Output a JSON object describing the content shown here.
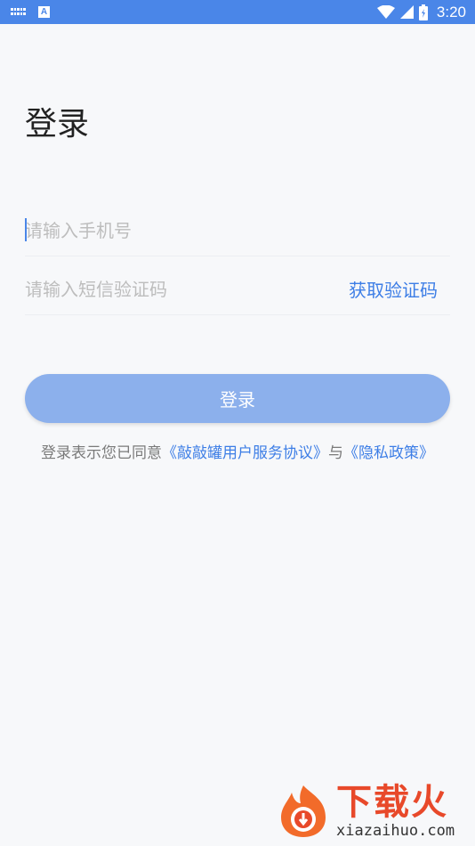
{
  "status_bar": {
    "time": "3:20",
    "battery_text": "",
    "icons": [
      "keyboard-icon",
      "a-notification-icon",
      "wifi-icon",
      "signal-icon",
      "battery-icon"
    ]
  },
  "page": {
    "title": "登录"
  },
  "form": {
    "phone_placeholder": "请输入手机号",
    "code_placeholder": "请输入短信验证码",
    "get_code_label": "获取验证码",
    "login_label": "登录"
  },
  "agreement": {
    "prefix": "登录表示您已同意",
    "terms_link": "《敲敲罐用户服务协议》",
    "conjunction": "与",
    "privacy_link": "《隐私政策》"
  },
  "watermark": {
    "brand_cn": "下载火",
    "brand_en": "xiazaihuo.com"
  },
  "colors": {
    "status_bar": "#4a86e8",
    "accent": "#3d7ee6",
    "button_disabled": "#8cb0ec",
    "background": "#f7f8fa"
  }
}
